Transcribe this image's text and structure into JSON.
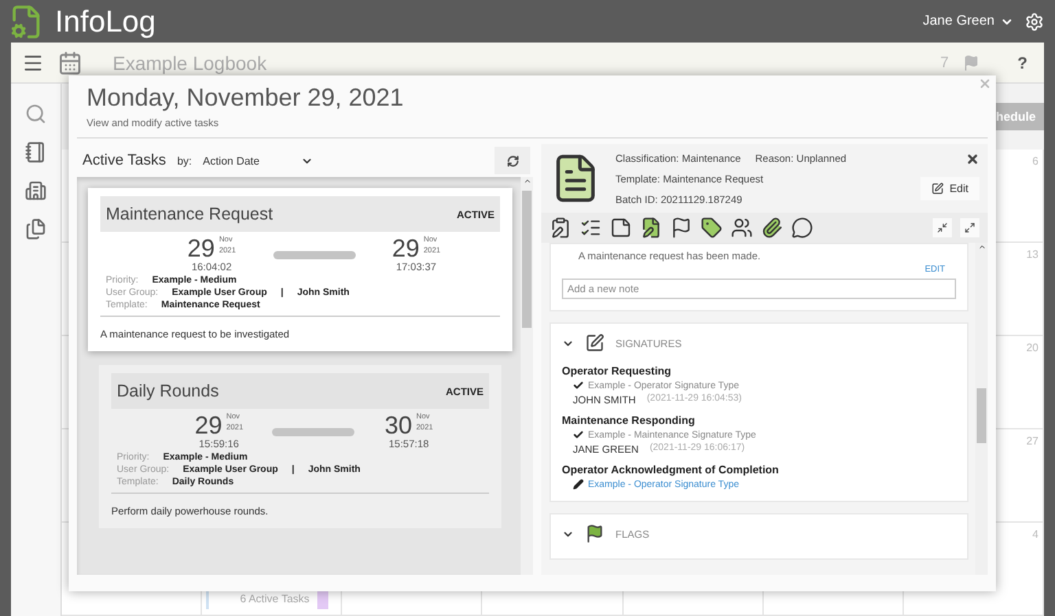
{
  "app": {
    "title": "InfoLog",
    "user": "Jane Green"
  },
  "logbook": {
    "title": "Example Logbook",
    "flag_count": "7",
    "help": "?"
  },
  "calendar": {
    "schedule_button": "hedule",
    "day_numbers": [
      "6",
      "13",
      "20",
      "27",
      "4"
    ],
    "cell_summary": "6 Active Tasks"
  },
  "modal": {
    "title": "Monday, November 29, 2021",
    "subtitle": "View and modify active tasks"
  },
  "active_tasks": {
    "title": "Active Tasks",
    "sort_label": "by:",
    "sort_value": "Action Date",
    "tasks": [
      {
        "name": "Maintenance Request",
        "status": "ACTIVE",
        "selected": true,
        "start": {
          "day": "29",
          "month": "Nov",
          "year": "2021",
          "time": "16:04:02"
        },
        "end": {
          "day": "29",
          "month": "Nov",
          "year": "2021",
          "time": "17:03:37"
        },
        "fields": [
          {
            "label": "Priority:",
            "value": "Example - Medium"
          },
          {
            "label": "User Group:",
            "value": "Example User Group",
            "separator": "|",
            "extra": "John Smith"
          },
          {
            "label": "Template:",
            "value": "Maintenance Request"
          }
        ],
        "description": "A maintenance request to be investigated"
      },
      {
        "name": "Daily Rounds",
        "status": "ACTIVE",
        "selected": false,
        "start": {
          "day": "29",
          "month": "Nov",
          "year": "2021",
          "time": "15:59:16"
        },
        "end": {
          "day": "30",
          "month": "Nov",
          "year": "2021",
          "time": "15:57:18"
        },
        "fields": [
          {
            "label": "Priority:",
            "value": "Example - Medium"
          },
          {
            "label": "User Group:",
            "value": "Example User Group",
            "separator": "|",
            "extra": "John Smith"
          },
          {
            "label": "Template:",
            "value": "Daily Rounds"
          }
        ],
        "description": "Perform daily powerhouse rounds."
      }
    ]
  },
  "details": {
    "classification_label": "Classification:",
    "classification": "Maintenance",
    "reason_label": "Reason:",
    "reason": "Unplanned",
    "template_label": "Template:",
    "template": "Maintenance Request",
    "batch_label": "Batch ID:",
    "batch_id": "20211129.187249",
    "edit_button": "Edit",
    "note_text": "A maintenance request has been made.",
    "note_edit": "EDIT",
    "note_placeholder": "Add a new note",
    "sections": [
      {
        "kind": "signatures",
        "title": "SIGNATURES",
        "expanded": true,
        "signatures": [
          {
            "role": "Operator Requesting",
            "type": "Example - Operator Signature Type",
            "signed": true,
            "signer": "JOHN SMITH",
            "time": "(2021-11-29 16:04:53)"
          },
          {
            "role": "Maintenance Responding",
            "type": "Example - Maintenance Signature Type",
            "signed": true,
            "signer": "JANE GREEN",
            "time": "(2021-11-29 16:06:17)"
          },
          {
            "role": "Operator Acknowledgment of Completion",
            "type": "Example - Operator Signature Type",
            "signed": false
          }
        ]
      },
      {
        "kind": "flags",
        "title": "FLAGS",
        "expanded": true
      }
    ]
  }
}
